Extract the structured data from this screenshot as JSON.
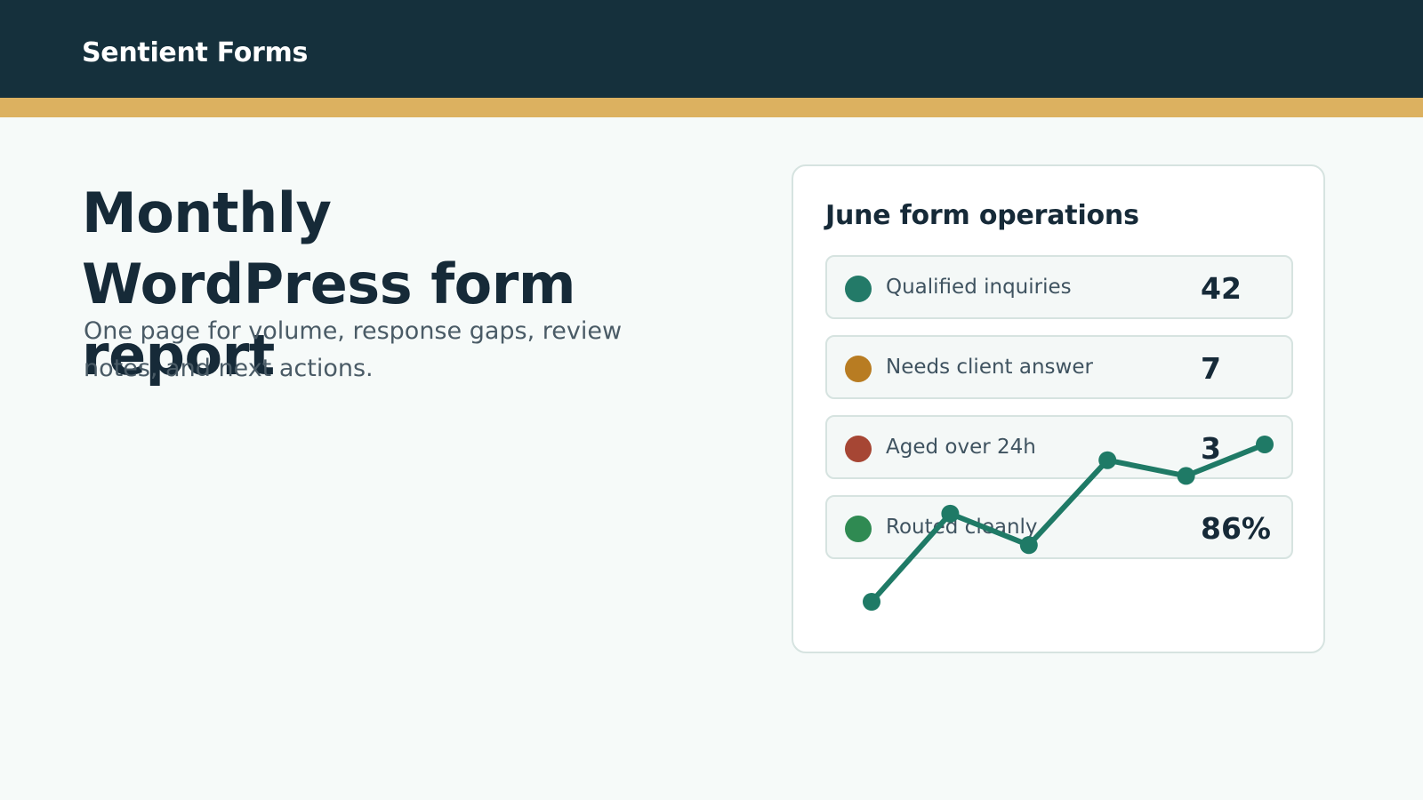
{
  "header": {
    "brand": "Sentient Forms"
  },
  "hero": {
    "title": "Monthly WordPress form report",
    "subtitle": "One page for volume, response gaps, review notes, and next actions."
  },
  "card": {
    "title": "June form operations",
    "metrics": [
      {
        "label": "Qualified inquiries",
        "value": "42",
        "color": "#237a68"
      },
      {
        "label": "Needs client answer",
        "value": "7",
        "color": "#b87c22"
      },
      {
        "label": "Aged over 24h",
        "value": "3",
        "color": "#a64634"
      },
      {
        "label": "Routed cleanly",
        "value": "86%",
        "color": "#2f8a52"
      }
    ]
  },
  "colors": {
    "header_bg": "#15303c",
    "accent": "#dcb160",
    "trend_line": "#1f7a66"
  },
  "chart_data": {
    "type": "line",
    "values": [
      0.0,
      0.56,
      0.36,
      0.9,
      0.8,
      1.0
    ],
    "grid": false,
    "legend": "none"
  }
}
